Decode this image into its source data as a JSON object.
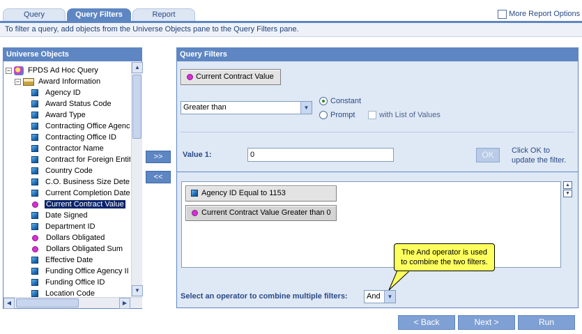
{
  "tabs": [
    {
      "label": "Query",
      "active": false
    },
    {
      "label": "Query Filters",
      "active": true
    },
    {
      "label": "Report",
      "active": false
    }
  ],
  "more_report_options": "More Report Options",
  "info_text": "To filter a query, add objects from the Universe Objects pane to the Query Filters pane.",
  "universe": {
    "title": "Universe Objects",
    "root_label": "FPDS Ad Hoc Query",
    "class_label": "Award Information",
    "items": [
      {
        "label": "Agency ID",
        "type": "dimension"
      },
      {
        "label": "Award Status Code",
        "type": "dimension"
      },
      {
        "label": "Award Type",
        "type": "dimension"
      },
      {
        "label": "Contracting Office Agenc",
        "type": "dimension"
      },
      {
        "label": "Contracting Office ID",
        "type": "dimension"
      },
      {
        "label": "Contractor Name",
        "type": "dimension"
      },
      {
        "label": "Contract for Foreign Entit",
        "type": "dimension"
      },
      {
        "label": "Country Code",
        "type": "dimension"
      },
      {
        "label": "C.O. Business Size Dete",
        "type": "dimension"
      },
      {
        "label": "Current Completion Date",
        "type": "dimension"
      },
      {
        "label": "Current Contract Value",
        "type": "measure",
        "selected": true
      },
      {
        "label": "Date Signed",
        "type": "dimension"
      },
      {
        "label": "Department ID",
        "type": "dimension"
      },
      {
        "label": "Dollars Obligated",
        "type": "measure"
      },
      {
        "label": "Dollars Obligated Sum",
        "type": "measure"
      },
      {
        "label": "Effective Date",
        "type": "dimension"
      },
      {
        "label": "Funding Office Agency II",
        "type": "dimension"
      },
      {
        "label": "Funding Office ID",
        "type": "dimension"
      },
      {
        "label": "Location Code",
        "type": "dimension"
      }
    ]
  },
  "arrows": {
    "add": ">>",
    "remove": "<<"
  },
  "query_filters": {
    "title": "Query Filters",
    "object_button": "Current Contract Value",
    "operator_select": "Greater than",
    "radio_constant": "Constant",
    "radio_prompt": "Prompt",
    "with_list_of_values": "with List of Values",
    "value_label": "Value 1:",
    "value_input": "0",
    "ok_label": "OK",
    "ok_help": "Click OK to\nupdate the filter.",
    "filters": [
      {
        "label": "Agency ID Equal to 1153",
        "type": "dimension"
      },
      {
        "label": "Current Contract Value Greater than 0",
        "type": "measure"
      }
    ],
    "combine_label": "Select an operator to combine multiple filters:",
    "combine_operator": "And",
    "callout": "The And operator is used\nto combine the two filters."
  },
  "buttons": {
    "back": "< Back",
    "next": "Next >",
    "run": "Run"
  }
}
